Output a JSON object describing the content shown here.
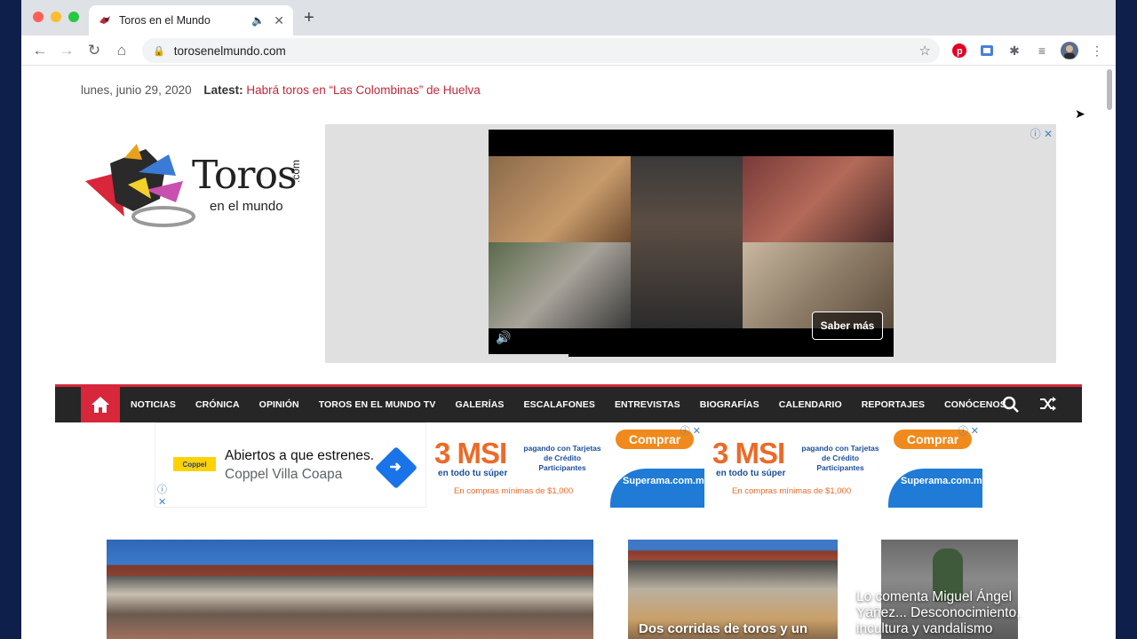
{
  "browser": {
    "tab_title": "Toros en el Mundo",
    "url": "torosenelmundo.com",
    "new_tab_symbol": "+"
  },
  "page": {
    "date": "lunes, junio 29, 2020",
    "latest_label": "Latest:",
    "latest_headline": "Habrá toros en “Las Colombinas” de Huelva",
    "logo": {
      "word": "Toros",
      "sub": "en el mundo",
      "com": ".com"
    },
    "video_ad": {
      "cta": "Saber más"
    },
    "nav": {
      "items": [
        "NOTICIAS",
        "CRÓNICA",
        "OPINIÓN",
        "TOROS EN EL MUNDO TV",
        "GALERÍAS",
        "ESCALAFONES",
        "ENTREVISTAS",
        "BIOGRAFÍAS",
        "CALENDARIO",
        "REPORTAJES",
        "CONÓCENOS"
      ]
    },
    "banner_coppel": {
      "brand": "Coppel",
      "headline": "Abiertos a que estrenes.",
      "subline": "Coppel Villa Coapa"
    },
    "banner_superama": {
      "big": "3 MSI",
      "paying": "pagando con Tarjetas de Crédito Participantes",
      "store_line": "en todo tu súper",
      "min_line": "En compras mínimas de $1,000",
      "cta": "Comprar",
      "brand": "Superama.com.mx"
    },
    "articles": [
      {
        "caption": ""
      },
      {
        "caption": "Dos corridas de toros y un"
      },
      {
        "caption": "Lo comenta Miguel Ángel Yáñez... Desconocimiento, incultura y vandalismo"
      }
    ]
  }
}
